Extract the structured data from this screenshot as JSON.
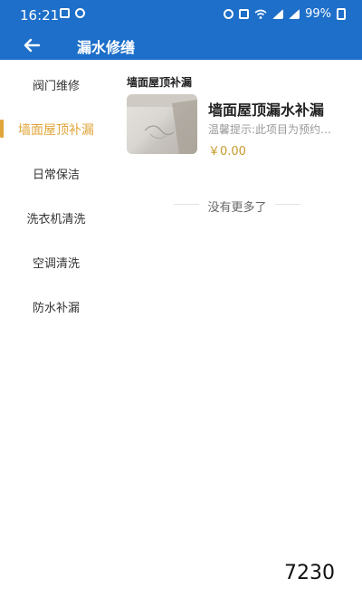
{
  "status_bar": {
    "time": "16:21",
    "battery": "99%",
    "icons_left": [
      "image-icon",
      "shield-icon"
    ],
    "icons_right": [
      "alarm-icon",
      "nfc-icon",
      "wifi-icon",
      "signal-icon",
      "signal-icon",
      "battery-icon"
    ]
  },
  "header": {
    "title": "漏水修缮",
    "back_icon": "arrow-left-icon",
    "background": "#1d6fc9"
  },
  "sidebar": {
    "items": [
      {
        "label": "阀门维修",
        "active": false
      },
      {
        "label": "墙面屋顶补漏",
        "active": true
      },
      {
        "label": "日常保洁",
        "active": false
      },
      {
        "label": "洗衣机清洗",
        "active": false
      },
      {
        "label": "空调清洗",
        "active": false
      },
      {
        "label": "防水补漏",
        "active": false
      }
    ],
    "active_color": "#e0a53a"
  },
  "main": {
    "section_title": "墙面屋顶补漏",
    "products": [
      {
        "title": "墙面屋顶漏水补漏",
        "description": "温馨提示:此项目为预约…",
        "price": "￥0.00"
      }
    ],
    "no_more_text": "没有更多了"
  },
  "overlay": {
    "number": "7230"
  }
}
